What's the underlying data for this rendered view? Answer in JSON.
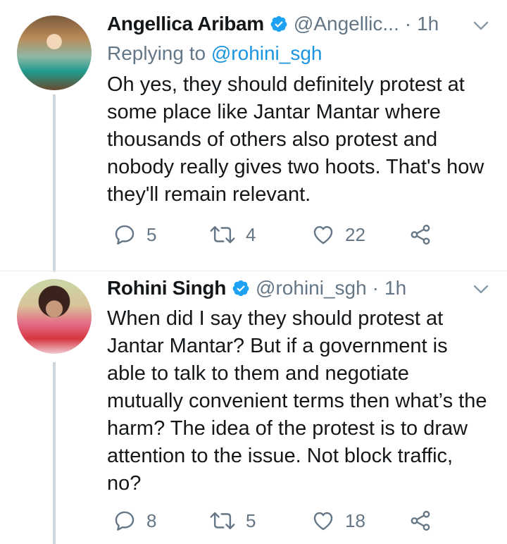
{
  "tweets": [
    {
      "name": "Angellica Aribam",
      "handle": "@Angellic...",
      "separator": "·",
      "time": "1h",
      "replying_prefix": "Replying to",
      "replying_to": "@rohini_sgh",
      "text": "Oh yes, they should definitely protest at some place like Jantar Mantar where thousands of others also protest and nobody really gives two hoots. That's how they'll remain relevant.",
      "replies": "5",
      "retweets": "4",
      "likes": "22"
    },
    {
      "name": "Rohini Singh",
      "handle": "@rohini_sgh",
      "separator": "·",
      "time": "1h",
      "text": "When did I say they should protest at Jantar Mantar? But if a government is able to talk to them and negotiate mutually convenient terms then what’s the harm? The idea of the protest is to draw attention to the issue. Not block traffic, no?",
      "replies": "8",
      "retweets": "5",
      "likes": "18"
    }
  ],
  "icons": {
    "verified": "verified-badge-icon",
    "reply": "reply-icon",
    "retweet": "retweet-icon",
    "like": "heart-icon",
    "share": "share-icon",
    "menu": "chevron-down-icon"
  },
  "colors": {
    "accent": "#1da1f2",
    "link": "#1b95e0",
    "muted": "#657786",
    "text": "#14171a",
    "thread_line": "#ccd6dd"
  }
}
